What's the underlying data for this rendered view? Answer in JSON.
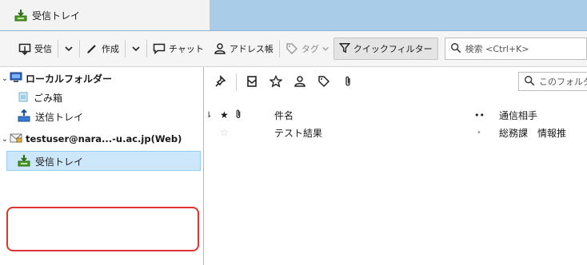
{
  "window": {
    "tab_title": "受信トレイ",
    "icons": [
      "inbox-tray-icon"
    ]
  },
  "toolbar": {
    "get_mail_label": "受信",
    "write_label": "作成",
    "chat_label": "チャット",
    "address_book_label": "アドレス帳",
    "tag_label": "タグ",
    "quick_filter_label": "クイックフィルター",
    "search_placeholder": "検索 <Ctrl+K>"
  },
  "sidebar": {
    "local_folders": {
      "label": "ローカルフォルダー",
      "items": [
        {
          "label": "ごみ箱",
          "icon": "trash-icon"
        },
        {
          "label": "送信トレイ",
          "icon": "outbox-icon"
        }
      ]
    },
    "account": {
      "label": "testuser@nara...-u.ac.jp(Web)",
      "items": [
        {
          "label": "受信トレイ",
          "icon": "inbox-tray-icon",
          "selected": true
        }
      ]
    }
  },
  "message_list": {
    "filter_search_placeholder": "このフォルダ",
    "columns": {
      "subject": "件名",
      "correspondents": "通信相手"
    },
    "rows": [
      {
        "starred": false,
        "subject": "テスト結果",
        "read": true,
        "correspondent": "総務課　情報推"
      }
    ]
  },
  "colors": {
    "titlebar": "#a9cde8",
    "selected_folder": "#cce6fa",
    "highlight_box": "#e23232"
  }
}
